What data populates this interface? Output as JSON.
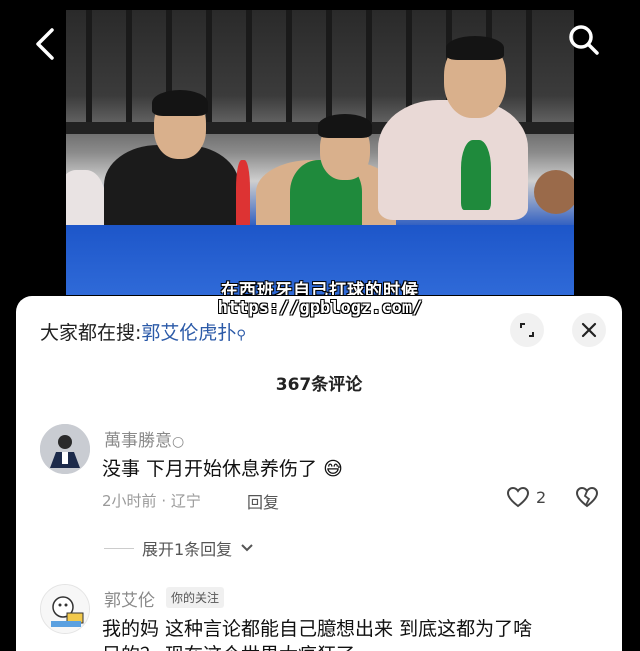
{
  "video": {
    "subtitle": "在西班牙自己打球的时候",
    "watermark": "https://gpblogz.com/"
  },
  "top_bar": {
    "back_icon": "back-arrow-icon",
    "search_icon": "search-icon"
  },
  "sheet": {
    "search_prefix": "大家都在搜:",
    "search_term": "郭艾伦虎扑",
    "comment_count": "367条评论",
    "expand_icon": "expand-corner-icon",
    "close_icon": "close-icon"
  },
  "comments": [
    {
      "name": "萬事勝意",
      "name_icon": "small-circle-icon",
      "text": "没事 下月开始休息养伤了",
      "emoji": "😅",
      "time": "2小时前",
      "location": "辽宁",
      "reply_label": "回复",
      "likes": "2",
      "expand_label": "展开1条回复"
    },
    {
      "name": "郭艾伦",
      "tag": "你的关注",
      "text": "我的妈 这种言论都能自己臆想出来 到底这都为了啥",
      "text2": "目的？ 现在这个世界太疯狂了"
    }
  ]
}
